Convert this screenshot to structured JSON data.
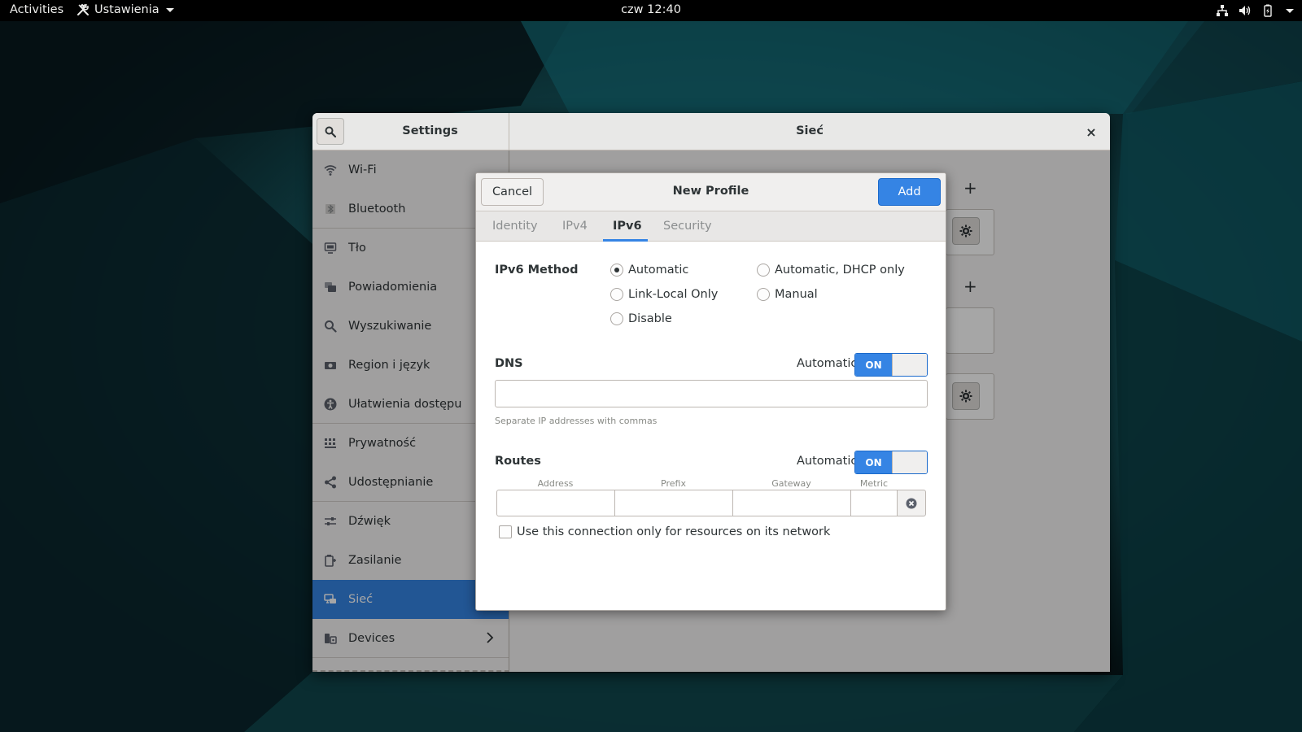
{
  "topbar": {
    "activities": "Activities",
    "app_name": "Ustawienia",
    "clock": "czw 12:40",
    "tray": [
      "network-icon",
      "volume-icon",
      "battery-icon",
      "system-menu-caret"
    ]
  },
  "window": {
    "sidebar_title": "Settings",
    "page_title": "Sieć",
    "close_label": "×"
  },
  "sidebar": {
    "items": [
      {
        "label": "Wi-Fi",
        "icon": "wifi-icon"
      },
      {
        "label": "Bluetooth",
        "icon": "bluetooth-icon"
      },
      {
        "label": "Tło",
        "icon": "background-icon"
      },
      {
        "label": "Powiadomienia",
        "icon": "notifications-icon"
      },
      {
        "label": "Wyszukiwanie",
        "icon": "search-icon"
      },
      {
        "label": "Region i język",
        "icon": "region-icon"
      },
      {
        "label": "Ułatwienia dostępu",
        "icon": "accessibility-icon"
      },
      {
        "label": "Prywatność",
        "icon": "privacy-icon"
      },
      {
        "label": "Udostępnianie",
        "icon": "sharing-icon"
      },
      {
        "label": "Dźwięk",
        "icon": "sound-icon"
      },
      {
        "label": "Zasilanie",
        "icon": "power-icon"
      },
      {
        "label": "Sieć",
        "icon": "network-icon"
      },
      {
        "label": "Devices",
        "icon": "devices-icon"
      }
    ],
    "active_index": 11
  },
  "dialog": {
    "title": "New Profile",
    "cancel_label": "Cancel",
    "add_label": "Add",
    "tabs": [
      "Identity",
      "IPv4",
      "IPv6",
      "Security"
    ],
    "active_tab": "IPv6",
    "ipv6_method": {
      "label": "IPv6 Method",
      "options": [
        "Automatic",
        "Automatic, DHCP only",
        "Link-Local Only",
        "Manual",
        "Disable"
      ],
      "selected": "Automatic"
    },
    "dns": {
      "label": "DNS",
      "automatic_label": "Automatic",
      "switch_label": "ON",
      "value": "",
      "hint": "Separate IP addresses with commas"
    },
    "routes": {
      "label": "Routes",
      "automatic_label": "Automatic",
      "switch_label": "ON",
      "columns": [
        "Address",
        "Prefix",
        "Gateway",
        "Metric"
      ]
    },
    "only_local_checkbox": {
      "label": "Use this connection only for resources on its network",
      "checked": false
    }
  },
  "colors": {
    "accent": "#3584e4",
    "topbar": "#000000",
    "window_bg": "#f6f5f4"
  }
}
